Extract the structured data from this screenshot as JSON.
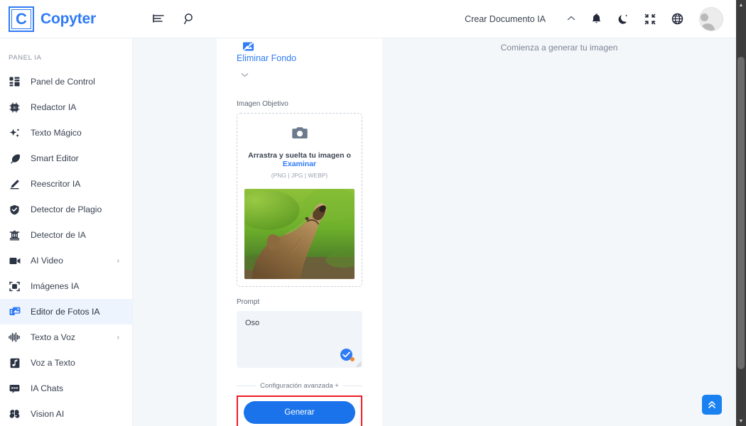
{
  "header": {
    "brand_letter": "C",
    "brand_name": "Copyter",
    "menu_icon": "list-menu-icon",
    "search_icon": "search-icon",
    "create_document_label": "Crear Documento IA",
    "collapse_caret": "chevron-up-icon",
    "notification_icon": "bell-icon",
    "theme_icon": "moon-icon",
    "fullscreen_icon": "compress-icon",
    "language_icon": "globe-icon",
    "avatar": "user-avatar"
  },
  "sidebar": {
    "section_label": "PANEL IA",
    "items": [
      {
        "label": "Panel de Control",
        "icon": "dashboard-icon",
        "active": false,
        "chevron": ""
      },
      {
        "label": "Redactor IA",
        "icon": "chip-ai-icon",
        "active": false,
        "chevron": ""
      },
      {
        "label": "Texto Mágico",
        "icon": "sparkles-icon",
        "active": false,
        "chevron": ""
      },
      {
        "label": "Smart Editor",
        "icon": "feather-pen-icon",
        "active": false,
        "chevron": ""
      },
      {
        "label": "Reescritor IA",
        "icon": "pencil-icon",
        "active": false,
        "chevron": ""
      },
      {
        "label": "Detector de Plagio",
        "icon": "shield-check-icon",
        "active": false,
        "chevron": ""
      },
      {
        "label": "Detector de IA",
        "icon": "robot-head-icon",
        "active": false,
        "chevron": ""
      },
      {
        "label": "AI Video",
        "icon": "video-camera-icon",
        "active": false,
        "chevron": "›"
      },
      {
        "label": "Imágenes IA",
        "icon": "image-frame-icon",
        "active": false,
        "chevron": ""
      },
      {
        "label": "Editor de Fotos IA",
        "icon": "photo-edit-icon",
        "active": true,
        "chevron": ""
      },
      {
        "label": "Texto a Voz",
        "icon": "waveform-icon",
        "active": false,
        "chevron": "›"
      },
      {
        "label": "Voz a Texto",
        "icon": "music-note-icon",
        "active": false,
        "chevron": ""
      },
      {
        "label": "IA Chats",
        "icon": "chat-bubble-icon",
        "active": false,
        "chevron": ""
      },
      {
        "label": "Vision AI",
        "icon": "brain-icon",
        "active": false,
        "chevron": ""
      }
    ]
  },
  "tool_panel": {
    "tool_icon": "remove-background-icon",
    "tool_title": "Eliminar Fondo",
    "caret": "chevron-down-icon",
    "target_image_label": "Imagen Objetivo",
    "dropzone": {
      "camera_icon": "camera-icon",
      "text_main": "Arrastra y suelta tu imagen o ",
      "browse_link": "Examinar",
      "formats": "(PNG | JPG | WEBP)"
    },
    "preview_alt": "bear-photo-preview",
    "prompt_label": "Prompt",
    "prompt_value": "Oso",
    "prompt_badge_icon": "check-circle-icon",
    "resize_handle": "resize-grip-icon",
    "advanced_settings": "Configuración avanzada +",
    "generate_label": "Generar",
    "highlight_color": "#ed1c24",
    "primary_color": "#1a73ea"
  },
  "result_pane": {
    "placeholder": "Comienza a generar tu imagen"
  },
  "floating": {
    "scroll_top_icon": "double-chevron-up-icon"
  },
  "scrollbar": {
    "up_arrow": "▲",
    "down_arrow": "▼"
  }
}
